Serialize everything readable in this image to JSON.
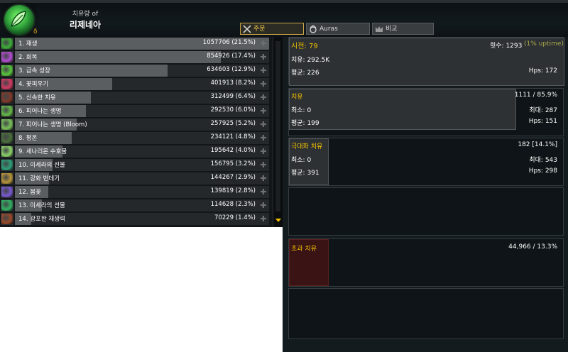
{
  "header": {
    "subtitle": "치유량 of",
    "player_name": "리제네아",
    "small_glyph": "ð"
  },
  "tabs": [
    {
      "label": "주문",
      "icon": "crossed-swords-icon",
      "active": true
    },
    {
      "label": "Auras",
      "icon": "aura-icon",
      "active": false
    },
    {
      "label": "비교",
      "icon": "crown-icon",
      "active": false
    }
  ],
  "spells": [
    {
      "name": "1. 재생",
      "value": "1057706 (21.5%)",
      "pct": 21.5,
      "icon_color": "#3fae3a"
    },
    {
      "name": "2. 회복",
      "value": "854926 (17.4%)",
      "pct": 17.4,
      "icon_color": "#b24fd0"
    },
    {
      "name": "3. 급속 성장",
      "value": "634603 (12.9%)",
      "pct": 12.9,
      "icon_color": "#5ac63d"
    },
    {
      "name": "4. 꽃피우기",
      "value": "401913 (8.2%)",
      "pct": 8.2,
      "icon_color": "#d33b63"
    },
    {
      "name": "5. 신속한 치유",
      "value": "312499 (6.4%)",
      "pct": 6.4,
      "icon_color": "#7f3a2a"
    },
    {
      "name": "6. 피어나는 생명",
      "value": "292530 (6.0%)",
      "pct": 6.0,
      "icon_color": "#65b94a"
    },
    {
      "name": "7. 피어나는 생명 (Bloom)",
      "value": "257925 (5.2%)",
      "pct": 5.2,
      "icon_color": "#7cc25c"
    },
    {
      "name": "8. 평온",
      "value": "234121 (4.8%)",
      "pct": 4.8,
      "icon_color": "#4a6f3a"
    },
    {
      "name": "9. 세나리온 수호물",
      "value": "195642 (4.0%)",
      "pct": 4.0,
      "icon_color": "#8cd26a"
    },
    {
      "name": "10. 이세라의 선물",
      "value": "156795 (3.2%)",
      "pct": 3.2,
      "icon_color": "#2fa07a"
    },
    {
      "name": "11. 강화 번데기",
      "value": "144267 (2.9%)",
      "pct": 2.9,
      "icon_color": "#b8963a"
    },
    {
      "name": "12. 봄꽃",
      "value": "139819 (2.8%)",
      "pct": 2.8,
      "icon_color": "#7a5ad0"
    },
    {
      "name": "13. 이세라의 선물",
      "value": "114628 (2.3%)",
      "pct": 2.3,
      "icon_color": "#34b265"
    },
    {
      "name": "14. 광포한 재생력",
      "value": "70229 (1.4%)",
      "pct": 1.4,
      "icon_color": "#9a4a2a"
    }
  ],
  "detail": {
    "casts_label": "시전: 79",
    "hits_label": "횟수: 1293",
    "uptime": "(1% uptime)",
    "heal_total": "치유: 292.5K",
    "avg": "평균: 226",
    "hps": "Hps: 172",
    "normal": {
      "title": "치유",
      "count": "1111 / 85.9%",
      "min": "최소: 0",
      "max": "최대: 287",
      "avg": "평균: 199",
      "hps": "Hps: 151"
    },
    "crit": {
      "title": "극대화 치유",
      "count": "182 [14.1%]",
      "min": "최소: 0",
      "max": "최대: 543",
      "avg": "평균: 391",
      "hps": "Hps: 298"
    },
    "overheal": {
      "title": "초과 치유",
      "value": "44,966 / 13.3%"
    }
  }
}
